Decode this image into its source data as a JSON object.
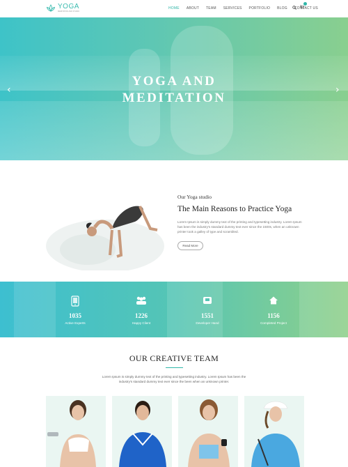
{
  "brand": {
    "name": "YOGA",
    "tagline": "MEDITATION AND STUDIO",
    "accent": "#2fb6a8"
  },
  "nav": {
    "items": [
      {
        "label": "HOME",
        "active": true
      },
      {
        "label": "ABOUT",
        "active": false
      },
      {
        "label": "TEAM",
        "active": false
      },
      {
        "label": "SERVICES",
        "active": false
      },
      {
        "label": "PORTFOLIO",
        "active": false
      },
      {
        "label": "BLOG",
        "active": false
      },
      {
        "label": "CONTACT US",
        "active": false
      }
    ],
    "search_icon": "search-icon",
    "cart_icon": "cart-icon"
  },
  "hero": {
    "line1": "YOGA AND",
    "line2": "MEDITATION",
    "prev_icon": "chevron-left-icon",
    "next_icon": "chevron-right-icon",
    "prev_glyph": "‹",
    "next_glyph": "›"
  },
  "about": {
    "subtitle": "Our Yoga studio",
    "title": "The Main Reasons to Practice Yoga",
    "text": "Lorem Ipsum is simply dummy text of the printing and typesetting industry. Lorem Ipsum has been the industry's standard dummy text ever since the 1500s, when an unknown printer took a galley of type and scrambled.",
    "button": "Read More"
  },
  "stats": [
    {
      "value": "1035",
      "label": "Active Experts",
      "icon": "tablet-icon"
    },
    {
      "value": "1226",
      "label": "Happy Client",
      "icon": "group-icon"
    },
    {
      "value": "1551",
      "label": "Developer Hand",
      "icon": "support-icon"
    },
    {
      "value": "1156",
      "label": "Completed Project",
      "icon": "home-icon"
    }
  ],
  "team": {
    "title": "OUR CREATIVE TEAM",
    "text": "Lorem Ipsum is simply dummy text of the printing and typesetting industry. Lorem Ipsum has been the industry's standard dummy text ever since the been when an unknown printer."
  }
}
